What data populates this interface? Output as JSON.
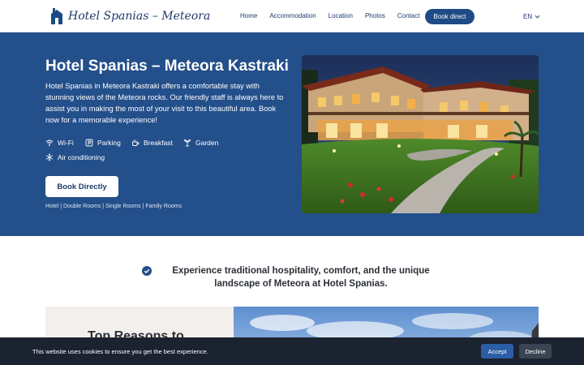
{
  "nav": {
    "logo_text": "Hotel Spanias – Meteora",
    "links": [
      "Home",
      "Accommodation",
      "Location",
      "Photos",
      "Contact"
    ],
    "cta": "Book direct",
    "language": "EN"
  },
  "hero": {
    "title": "Hotel Spanias – Meteora Kastraki",
    "description": "Hotel Spanias in Meteora Kastraki offers a comfortable stay with stunning views of the Meteora rocks. Our friendly staff is always here to assist you in making the most of your visit to this beautiful area. Book now for a memorable experience!",
    "amenities": [
      {
        "label": "Wi-Fi",
        "icon": "wifi-icon"
      },
      {
        "label": "Parking",
        "icon": "parking-icon"
      },
      {
        "label": "Breakfast",
        "icon": "coffee-icon"
      },
      {
        "label": "Garden",
        "icon": "garden-icon"
      },
      {
        "label": "Air conditioning",
        "icon": "snowflake-icon"
      }
    ],
    "book_button": "Book Directly",
    "tags": "Hotel | Double Rooms | Single Rooms | Family Rooms"
  },
  "section": {
    "tagline": "Experience traditional hospitality, comfort, and the unique landscape of Meteora at Hotel Spanias.",
    "reasons_title": "Top Reasons to"
  },
  "cookie": {
    "text": "This website uses cookies to ensure you get the best experience.",
    "accept": "Accept",
    "decline": "Decline"
  },
  "colors": {
    "brand": "#1e3a6b",
    "hero_bg": "#234f8a",
    "accept": "#2b5ea7",
    "cookie_bg": "#1b2230"
  }
}
